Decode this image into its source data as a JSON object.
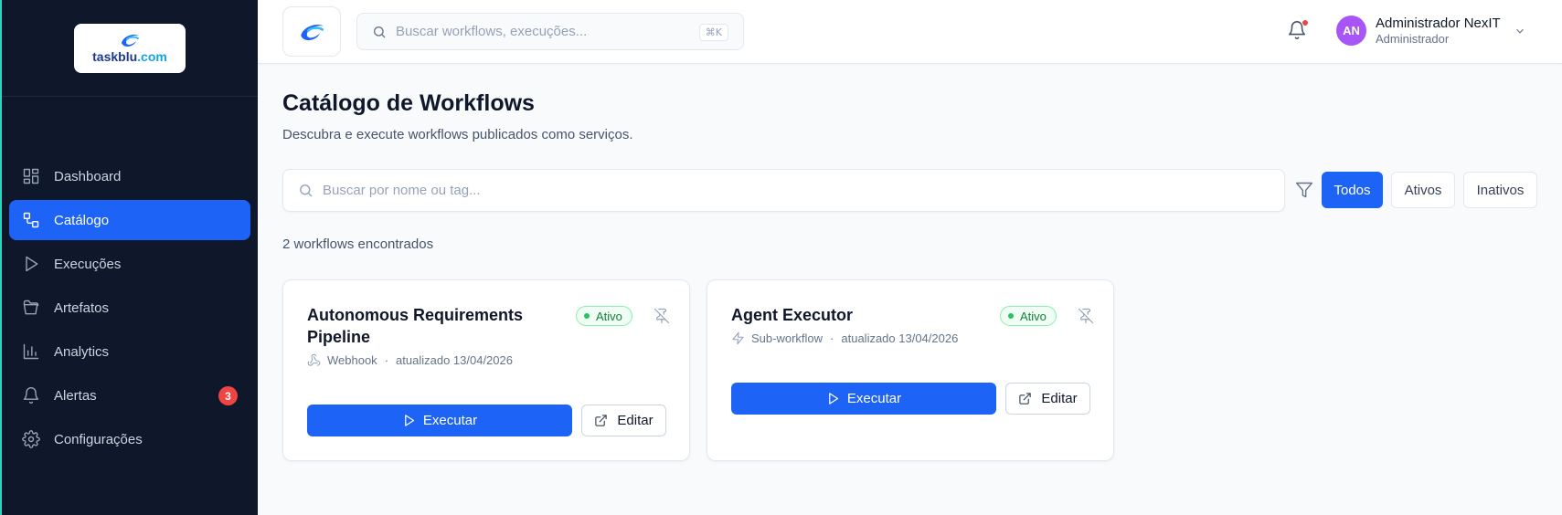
{
  "brand": {
    "logo_text_main": "taskblu",
    "logo_text_suffix": ".com"
  },
  "sidebar": {
    "items": [
      {
        "label": "Dashboard",
        "icon": "dashboard-icon",
        "active": false
      },
      {
        "label": "Catálogo",
        "icon": "catalog-icon",
        "active": true
      },
      {
        "label": "Execuções",
        "icon": "play-icon",
        "active": false
      },
      {
        "label": "Artefatos",
        "icon": "folder-icon",
        "active": false
      },
      {
        "label": "Analytics",
        "icon": "bar-chart-icon",
        "active": false
      },
      {
        "label": "Alertas",
        "icon": "bell-icon",
        "active": false,
        "badge": "3"
      },
      {
        "label": "Configurações",
        "icon": "gear-icon",
        "active": false
      }
    ]
  },
  "topbar": {
    "search_placeholder": "Buscar workflows, execuções...",
    "shortcut": "⌘K",
    "user": {
      "initials": "AN",
      "name": "Administrador NexIT",
      "role": "Administrador"
    }
  },
  "main": {
    "title": "Catálogo de Workflows",
    "subtitle": "Descubra e execute workflows publicados como serviços.",
    "search_placeholder": "Buscar por nome ou tag...",
    "filters": [
      "Todos",
      "Ativos",
      "Inativos"
    ],
    "active_filter": "Todos",
    "count_text": "2 workflows encontrados",
    "cards": [
      {
        "title": "Autonomous Requirements Pipeline",
        "status": "Ativo",
        "trigger": "Webhook",
        "updated": "atualizado 13/04/2026",
        "run_label": "Executar",
        "edit_label": "Editar"
      },
      {
        "title": "Agent Executor",
        "status": "Ativo",
        "trigger": "Sub-workflow",
        "updated": "atualizado 13/04/2026",
        "run_label": "Executar",
        "edit_label": "Editar"
      }
    ]
  },
  "colors": {
    "primary": "#1d63f5",
    "sidebar_bg": "#0f172a",
    "success": "#22c55e",
    "danger": "#ef4444",
    "avatar": "#a855f7"
  }
}
